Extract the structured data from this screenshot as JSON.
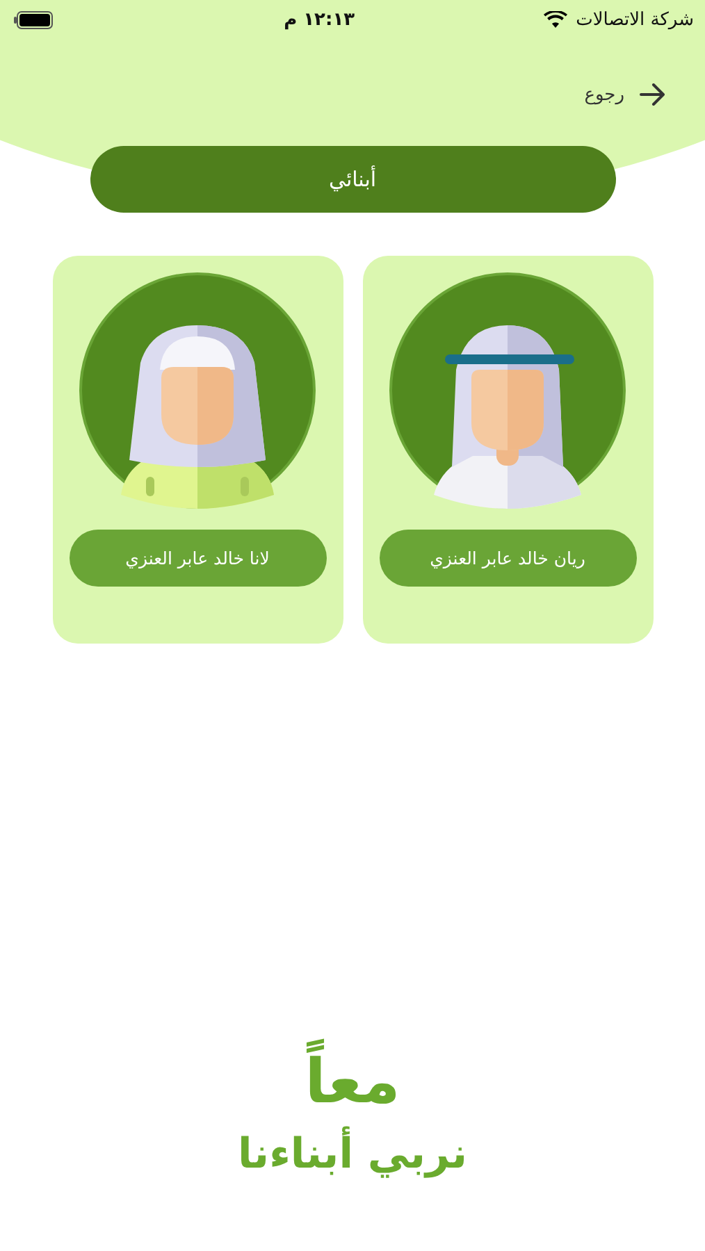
{
  "status_bar": {
    "carrier": "شركة الاتصالات",
    "time": "١٢:١٣ م"
  },
  "back": {
    "label": "رجوع"
  },
  "title": "أبنائي",
  "children": [
    {
      "name": "ريان خالد عابر العنزي",
      "kind": "boy"
    },
    {
      "name": "لانا خالد عابر العنزي",
      "kind": "girl"
    }
  ],
  "logo": {
    "line_1": "معاً",
    "line_2": "نربي أبناءنا"
  }
}
